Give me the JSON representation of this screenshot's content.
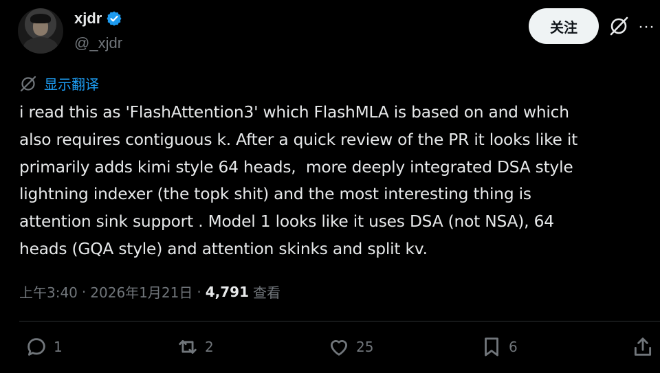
{
  "author": {
    "display_name": "xjdr",
    "handle": "@_xjdr",
    "verified": true,
    "avatar_icon": "profile-photo"
  },
  "header": {
    "follow_label": "关注",
    "grok_icon": "grok-icon",
    "more_label": "···"
  },
  "translate": {
    "label": "显示翻译",
    "icon": "globe-icon"
  },
  "tweet": {
    "text": "i read this as 'FlashAttention3' which FlashMLA is based on and which\nalso requires contiguous k. After a quick review of the PR it looks like it\nprimarily adds kimi style 64 heads,  more deeply integrated DSA style\nlightning indexer (the topk shit) and the most interesting thing is\nattention sink support . Model 1 looks like it uses DSA (not NSA), 64\nheads (GQA style) and attention skinks and split kv."
  },
  "meta": {
    "time": "上午3:40",
    "date": "2026年1月21日",
    "views_count": "4,791",
    "views_label": "查看",
    "separator": "·"
  },
  "actions": {
    "replies": "1",
    "reposts": "2",
    "likes": "25",
    "bookmarks": "6"
  },
  "colors": {
    "background": "#000000",
    "text": "#e7e9ea",
    "muted": "#71767b",
    "accent": "#1d9bf0"
  }
}
